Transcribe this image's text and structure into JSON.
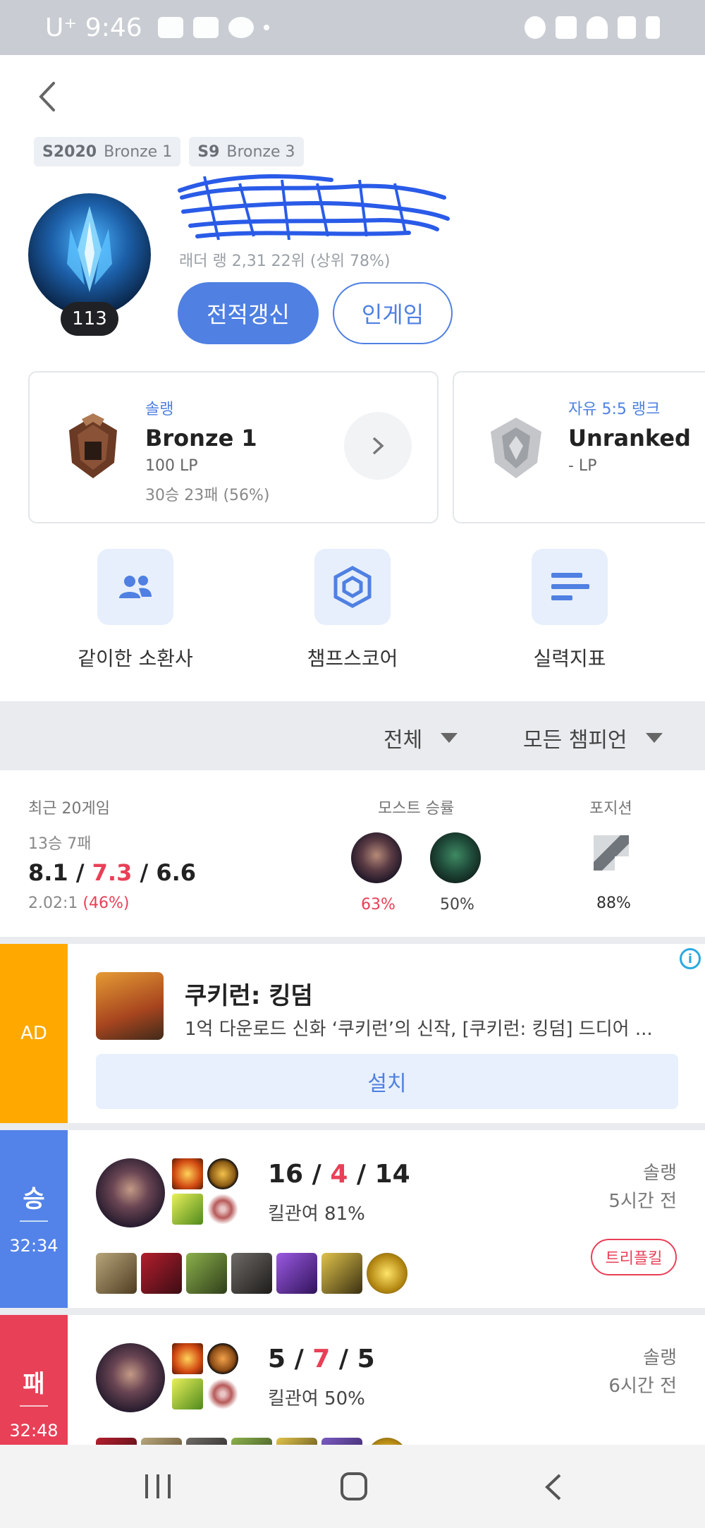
{
  "status_bar": {
    "carrier_time": "U⁺ 9:46"
  },
  "header": {
    "back_label": ""
  },
  "seasons": [
    {
      "season": "S2020",
      "tier": "Bronze 1"
    },
    {
      "season": "S9",
      "tier": "Bronze 3"
    }
  ],
  "profile": {
    "level": "113",
    "ladder_text": "래더 랭 2,31 22위 (상위 78%)",
    "refresh_button": "전적갱신",
    "ingame_button": "인게임"
  },
  "rank_cards": [
    {
      "queue": "솔랭",
      "tier": "Bronze 1",
      "lp": "100 LP",
      "record": "30승 23패 (56%)"
    },
    {
      "queue": "자유 5:5 랭크",
      "tier": "Unranked",
      "lp": "- LP"
    }
  ],
  "quick_menu": [
    {
      "label": "같이한 소환사",
      "icon": "people-icon"
    },
    {
      "label": "챔프스코어",
      "icon": "hexagon-icon"
    },
    {
      "label": "실력지표",
      "icon": "bars-icon"
    }
  ],
  "filters": {
    "queue": "전체",
    "champion": "모든 챔피언"
  },
  "recent_stats": {
    "title": "최근 20게임",
    "record": "13승 7패",
    "kills": "8.1",
    "deaths": "7.3",
    "assists": "6.6",
    "kda_ratio": "2.02:1",
    "kill_participation": "(46%)",
    "most_label": "모스트 승률",
    "most_champs": [
      {
        "winrate": "63%"
      },
      {
        "winrate": "50%"
      }
    ],
    "position_label": "포지션",
    "position_pct": "88%"
  },
  "ad": {
    "badge": "AD",
    "title": "쿠키런: 킹덤",
    "description": "1억 다운로드 신화 ‘쿠키런’의 신작, [쿠키런: 킹덤] 드디어 ...",
    "install_button": "설치",
    "info_icon": "i"
  },
  "matches": [
    {
      "result": "승",
      "duration": "32:34",
      "kills": "16",
      "deaths": "4",
      "assists": "14",
      "kill_participation": "킬관여 81%",
      "queue": "솔랭",
      "time_ago": "5시간 전",
      "badge": "트리플킬",
      "color": "#5383e8"
    },
    {
      "result": "패",
      "duration": "32:48",
      "kills": "5",
      "deaths": "7",
      "assists": "5",
      "kill_participation": "킬관여 50%",
      "queue": "솔랭",
      "time_ago": "6시간 전",
      "color": "#e84057"
    }
  ],
  "colors": {
    "accent": "#4f80e2",
    "win": "#5383e8",
    "loss": "#e84057",
    "ad": "#ffa800"
  }
}
